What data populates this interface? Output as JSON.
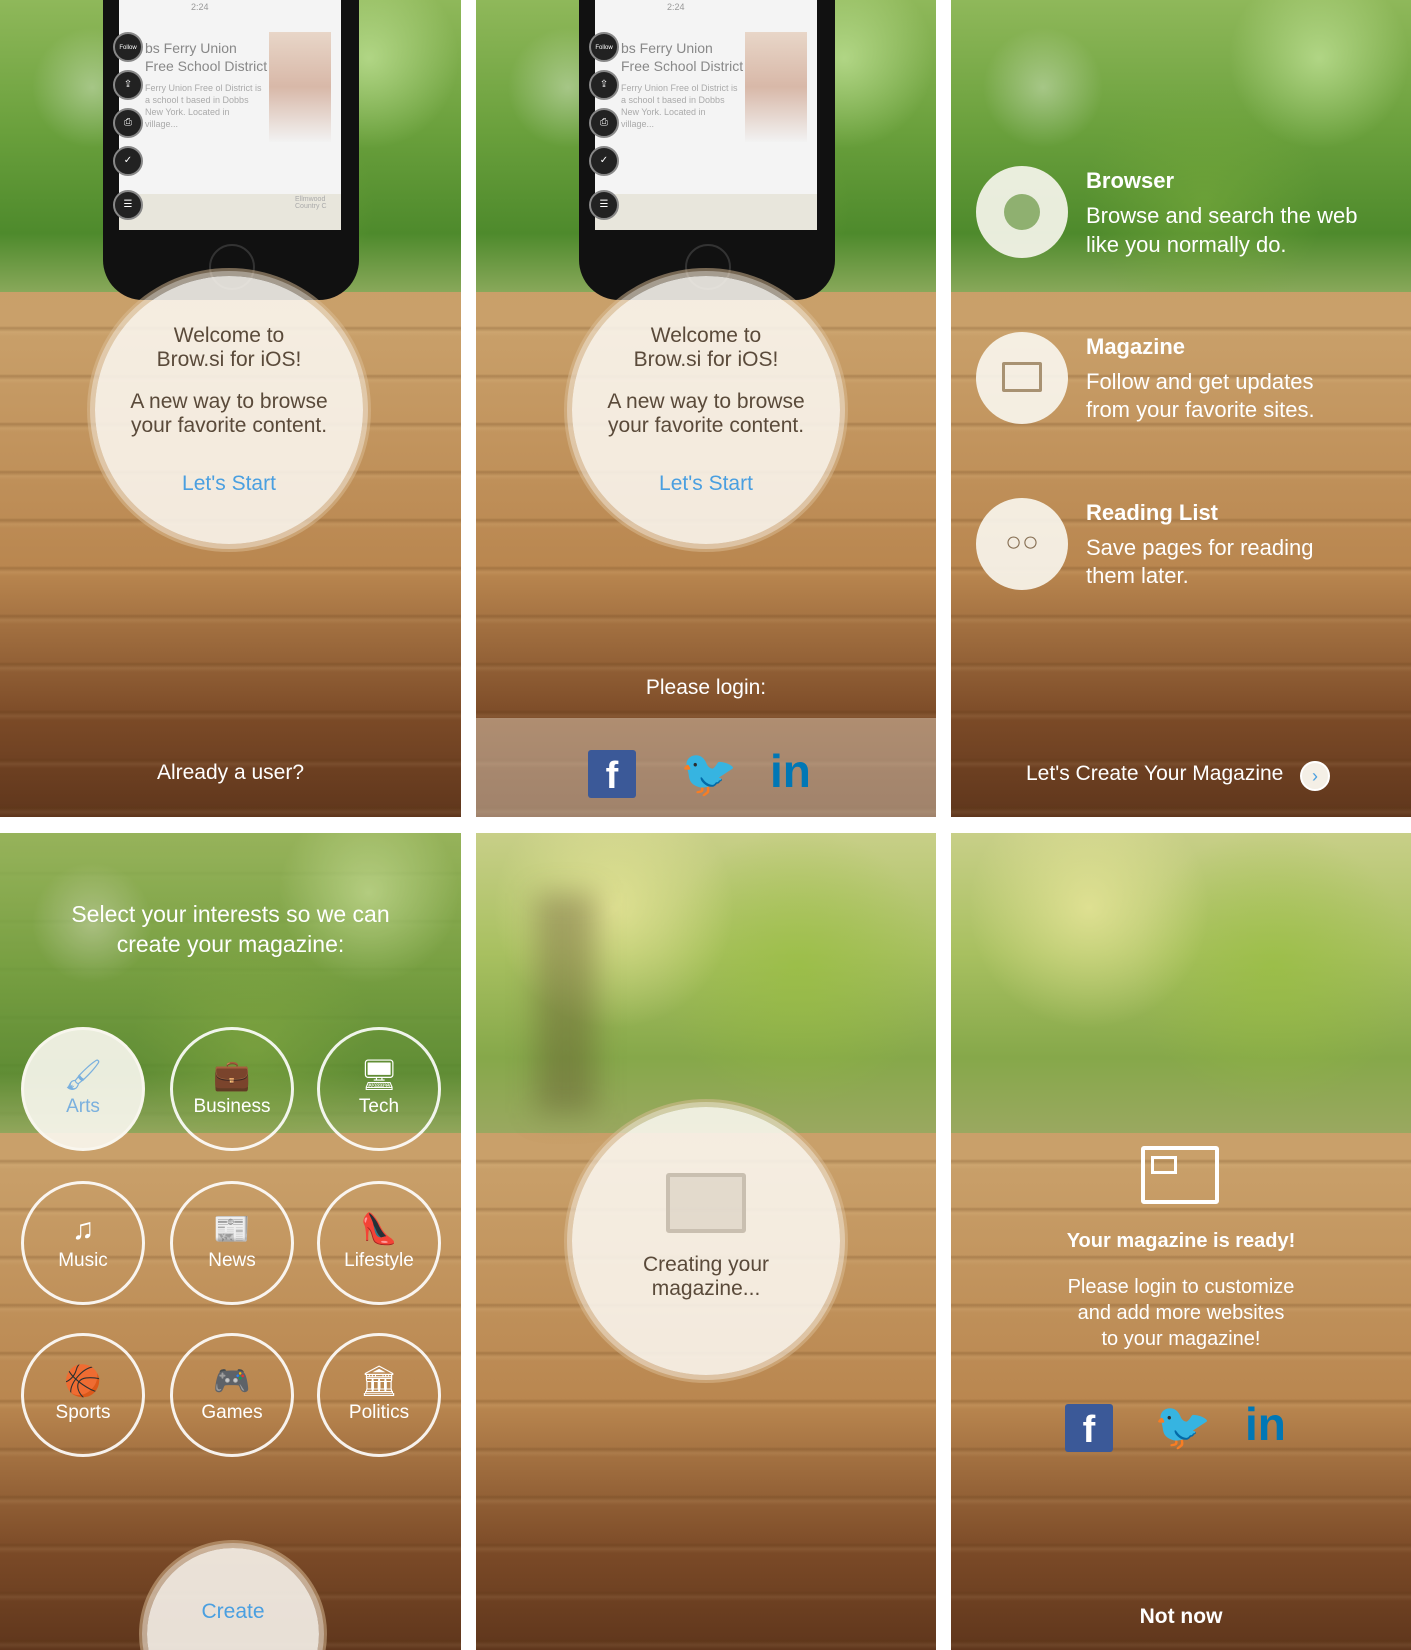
{
  "panels": {
    "welcome": {
      "title_line1": "Welcome to",
      "title_line2": "Brow.si for iOS!",
      "sub_line1": "A new way to browse",
      "sub_line2": "your favorite content.",
      "start_link": "Let's Start",
      "footer": "Already a user?",
      "phone": {
        "status_time": "2:24",
        "follow_label": "Follow",
        "headline_line1": "bs Ferry Union",
        "headline_line2": "Free School District",
        "body": "Ferry Union Free ol District is a school t based in Dobbs New York. Located in village...",
        "map_label": "Ellmwood Country C"
      }
    },
    "login": {
      "title_line1": "Welcome to",
      "title_line2": "Brow.si for iOS!",
      "sub_line1": "A new way to browse",
      "sub_line2": "your favorite content.",
      "start_link": "Let's Start",
      "prompt": "Please login:"
    },
    "features": {
      "items": [
        {
          "title": "Browser",
          "line1": "Browse and search the web",
          "line2": "like you normally do.",
          "icon": "globe-icon"
        },
        {
          "title": "Magazine",
          "line1": "Follow and get updates",
          "line2": "from your favorite sites.",
          "icon": "newspaper-icon"
        },
        {
          "title": "Reading List",
          "line1": "Save pages for reading",
          "line2": "them later.",
          "icon": "glasses-icon"
        }
      ],
      "footer": "Let's Create Your Magazine"
    },
    "interests": {
      "heading_line1": "Select your interests so we can",
      "heading_line2": "create your magazine:",
      "items": [
        {
          "label": "Arts",
          "icon": "brush-icon",
          "glyph": "🖌",
          "selected": true
        },
        {
          "label": "Business",
          "icon": "briefcase-icon",
          "glyph": "💼",
          "selected": false
        },
        {
          "label": "Tech",
          "icon": "monitor-icon",
          "glyph": "🖥",
          "selected": false
        },
        {
          "label": "Music",
          "icon": "music-note-icon",
          "glyph": "♫",
          "selected": false
        },
        {
          "label": "News",
          "icon": "newspaper-icon",
          "glyph": "📰",
          "selected": false
        },
        {
          "label": "Lifestyle",
          "icon": "high-heel-icon",
          "glyph": "👠",
          "selected": false
        },
        {
          "label": "Sports",
          "icon": "basketball-icon",
          "glyph": "🏀",
          "selected": false
        },
        {
          "label": "Games",
          "icon": "gamepad-icon",
          "glyph": "🎮",
          "selected": false
        },
        {
          "label": "Politics",
          "icon": "capitol-icon",
          "glyph": "🏛",
          "selected": false
        }
      ],
      "create": "Create"
    },
    "creating": {
      "line1": "Creating your",
      "line2": "magazine..."
    },
    "ready": {
      "title": "Your magazine is ready!",
      "line1": "Please login to customize",
      "line2": "and add more websites",
      "line3": "to your magazine!",
      "not_now": "Not now"
    }
  },
  "colors": {
    "link_blue": "#4a9fe0",
    "facebook": "#3b5998",
    "twitter": "#1da1f2",
    "linkedin": "#0077b5"
  }
}
